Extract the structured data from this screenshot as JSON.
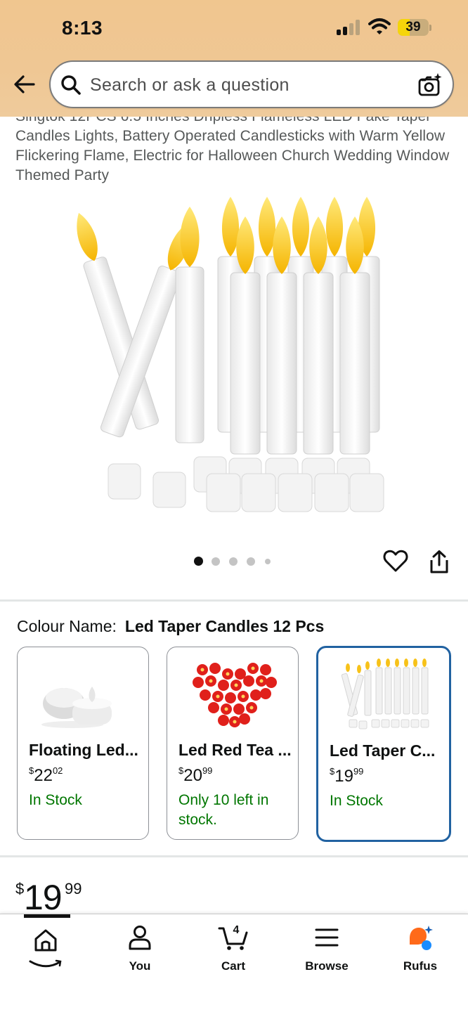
{
  "status_bar": {
    "time": "8:13",
    "battery": "39"
  },
  "search": {
    "placeholder": "Search or ask a question"
  },
  "product": {
    "title": "Singtok 12PCS 6.5 Inches Dripless Flameless LED Fake Taper Candles Lights, Battery Operated Candlesticks with Warm Yellow Flickering Flame, Electric for Halloween Church Wedding Window Themed Party"
  },
  "carousel": {
    "dots": 5,
    "active": 0
  },
  "colour": {
    "label": "Colour Name:",
    "value": "Led Taper Candles 12 Pcs"
  },
  "variants": [
    {
      "name": "Floating Led...",
      "currency": "$",
      "whole": "22",
      "fraction": "02",
      "stock": "In Stock",
      "selected": false
    },
    {
      "name": "Led Red Tea ...",
      "currency": "$",
      "whole": "20",
      "fraction": "99",
      "stock": "Only 10 left in stock.",
      "selected": false
    },
    {
      "name": "Led Taper C...",
      "currency": "$",
      "whole": "19",
      "fraction": "99",
      "stock": "In Stock",
      "selected": true
    }
  ],
  "price": {
    "currency": "$",
    "whole": "19",
    "fraction": "99"
  },
  "nav": {
    "items": [
      {
        "label": "",
        "icon": "home-icon"
      },
      {
        "label": "You",
        "icon": "person-icon"
      },
      {
        "label": "Cart",
        "icon": "cart-icon",
        "count": "4"
      },
      {
        "label": "Browse",
        "icon": "menu-icon"
      },
      {
        "label": "Rufus",
        "icon": "rufus-icon"
      }
    ]
  },
  "colors": {
    "accent_blue": "#2162a1",
    "stock_green": "#007600",
    "header_bg": "#f0c68f"
  }
}
